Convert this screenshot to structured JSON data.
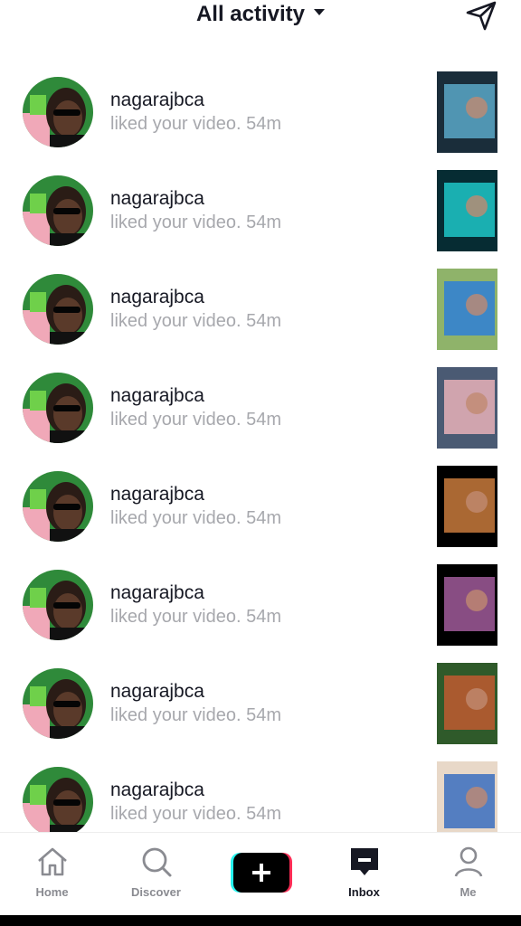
{
  "header": {
    "title": "All activity"
  },
  "notifications": [
    {
      "username": "nagarajbca",
      "text": "liked your video. 54m",
      "thumb_colors": [
        "#1a2d3a",
        "#5aa8c8"
      ]
    },
    {
      "username": "nagarajbca",
      "text": "liked your video. 54m",
      "thumb_colors": [
        "#062c33",
        "#1fc7c8"
      ]
    },
    {
      "username": "nagarajbca",
      "text": "liked your video. 54m",
      "thumb_colors": [
        "#8fb36a",
        "#2f7fd6"
      ]
    },
    {
      "username": "nagarajbca",
      "text": "liked your video. 54m",
      "thumb_colors": [
        "#4a5a73",
        "#e8b2b8"
      ]
    },
    {
      "username": "nagarajbca",
      "text": "liked your video. 54m",
      "thumb_colors": [
        "#000000",
        "#c87a3c"
      ]
    },
    {
      "username": "nagarajbca",
      "text": "liked your video. 54m",
      "thumb_colors": [
        "#000000",
        "#a05a9a"
      ]
    },
    {
      "username": "nagarajbca",
      "text": "liked your video. 54m",
      "thumb_colors": [
        "#2f5a2a",
        "#c05a30"
      ]
    },
    {
      "username": "nagarajbca",
      "text": "liked your video. 54m",
      "thumb_colors": [
        "#e8d8c8",
        "#3a6fc0"
      ]
    }
  ],
  "tabs": [
    {
      "label": "Home",
      "icon": "home-icon",
      "active": false
    },
    {
      "label": "Discover",
      "icon": "search-icon",
      "active": false
    },
    {
      "label": "",
      "icon": "create-icon",
      "active": false
    },
    {
      "label": "Inbox",
      "icon": "inbox-icon",
      "active": true
    },
    {
      "label": "Me",
      "icon": "profile-icon",
      "active": false
    }
  ],
  "colors": {
    "text": "#161823",
    "muted": "#a7a8ad",
    "accent_cyan": "#25f4ee",
    "accent_red": "#fe2c55"
  }
}
